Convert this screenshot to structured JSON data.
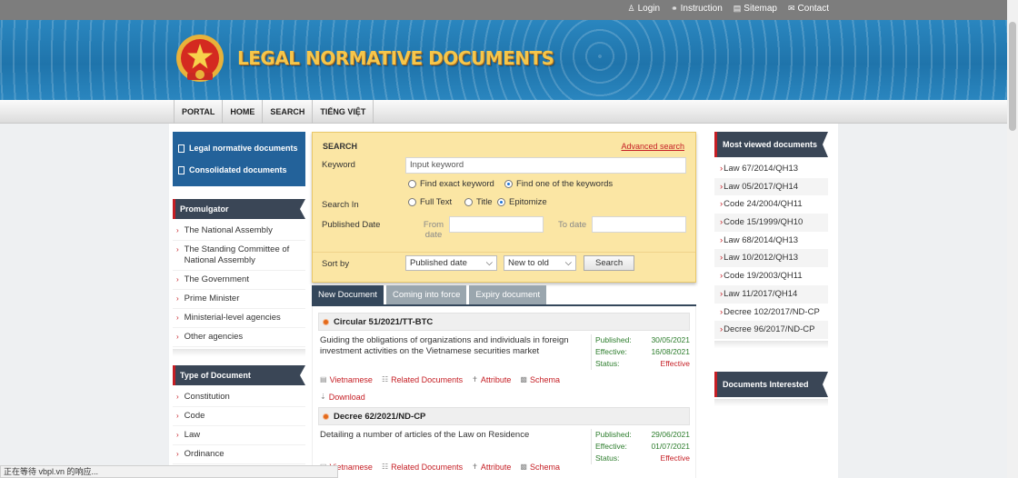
{
  "topbar": {
    "links": [
      {
        "label": "Login",
        "icon": "user-icon"
      },
      {
        "label": "Instruction",
        "icon": "headset-icon"
      },
      {
        "label": "Sitemap",
        "icon": "chart-icon"
      },
      {
        "label": "Contact",
        "icon": "envelope-icon"
      }
    ]
  },
  "banner": {
    "title": "LEGAL NORMATIVE DOCUMENTS"
  },
  "nav": {
    "items": [
      "PORTAL",
      "HOME",
      "SEARCH",
      "TIẾNG VIỆT"
    ]
  },
  "left": {
    "quick_links": [
      "Legal normative documents",
      "Consolidated documents"
    ],
    "promulgator": {
      "title": "Promulgator",
      "items": [
        "The National Assembly",
        "The Standing Committee of National Assembly",
        "The Government",
        "Prime Minister",
        "Ministerial-level agencies",
        "Other agencies"
      ]
    },
    "doc_type": {
      "title": "Type of Document",
      "items": [
        "Constitution",
        "Code",
        "Law",
        "Ordinance"
      ]
    }
  },
  "search": {
    "title": "SEARCH",
    "advanced": "Advanced search",
    "keyword_label": "Keyword",
    "keyword_value": "Input keyword",
    "find_exact": "Find exact keyword",
    "find_one": "Find one of the keywords",
    "search_in_label": "Search In",
    "full_text": "Full Text",
    "title_opt": "Title",
    "epitomize": "Epitomize",
    "published_label": "Published Date",
    "from_date": "From date",
    "to_date": "To date",
    "sort_label": "Sort by",
    "sort_field": "Published date",
    "sort_order": "New to old",
    "search_button": "Search"
  },
  "tabs": [
    "New Document",
    "Coming into force",
    "Expiry document"
  ],
  "documents": [
    {
      "title": "Circular 51/2021/TT-BTC",
      "description": "Guiding the obligations of organizations and individuals in foreign investment activities on the Vietnamese securities market",
      "published_label": "Published:",
      "published": "30/05/2021",
      "effective_label": "Effective:",
      "effective": "16/08/2021",
      "status_label": "Status:",
      "status": "Effective",
      "actions": [
        "Vietnamese",
        "Related Documents",
        "Attribute",
        "Schema",
        "Download"
      ]
    },
    {
      "title": "Decree 62/2021/ND-CP",
      "description": "Detailing a number of articles of the Law on Residence",
      "published_label": "Published:",
      "published": "29/06/2021",
      "effective_label": "Effective:",
      "effective": "01/07/2021",
      "status_label": "Status:",
      "status": "Effective",
      "actions": [
        "Vietnamese",
        "Related Documents",
        "Attribute",
        "Schema"
      ]
    }
  ],
  "right": {
    "most_viewed_title": "Most viewed documents",
    "most_viewed": [
      "Law 67/2014/QH13",
      "Law 05/2017/QH14",
      "Code 24/2004/QH11",
      "Code 15/1999/QH10",
      "Law 68/2014/QH13",
      "Law 10/2012/QH13",
      "Code 19/2003/QH11",
      "Law 11/2017/QH14",
      "Decree 102/2017/ND-CP",
      "Decree 96/2017/ND-CP"
    ],
    "interested_title": "Documents Interested"
  },
  "statusbar": {
    "text": "正在等待 vbpl.vn 的响应..."
  },
  "colors": {
    "banner": "#2a86bf",
    "title_gold": "#f6c64a",
    "dark_nav": "#3a4656",
    "accent_red": "#c51e24",
    "search_bg": "#fbe6a4"
  }
}
